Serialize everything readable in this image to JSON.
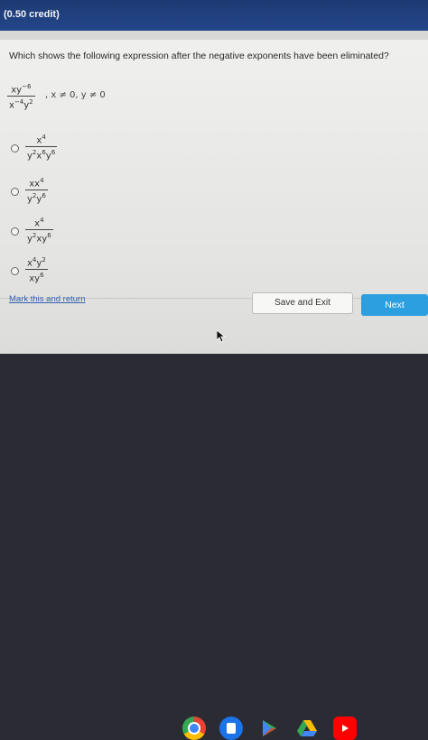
{
  "header": {
    "credit": "(0.50 credit)"
  },
  "question": {
    "text": "Which shows the following expression after the negative exponents have been eliminated?",
    "expr_num": "xy",
    "expr_num_exp": "−6",
    "expr_den_a": "x",
    "expr_den_a_exp": "−4",
    "expr_den_b": "y",
    "expr_den_b_exp": "2",
    "condition": ", x ≠ 0, y ≠ 0"
  },
  "options": [
    {
      "num": "x",
      "num_exp": "4",
      "den": "y",
      "den_exp1": "2",
      "den_mid": "x",
      "den_exp2": "6",
      "den_end": "y",
      "den_exp3": "6"
    },
    {
      "num": "xx",
      "num_exp": "4",
      "den": "y",
      "den_exp1": "2",
      "den_end": "y",
      "den_exp3": "6"
    },
    {
      "num": "x",
      "num_exp": "4",
      "den": "y",
      "den_exp1": "2",
      "den_mid": "xy",
      "den_exp2": "6"
    },
    {
      "num": "x",
      "num_exp": "4",
      "num2": "y",
      "num_exp2": "2",
      "den": "xy",
      "den_exp1": "6"
    }
  ],
  "footer": {
    "mark_label": "Mark this and return",
    "save_label": "Save and Exit",
    "next_label": "Next"
  },
  "colors": {
    "header": "#23468a",
    "next": "#2c9fe0",
    "link": "#2f62b0"
  },
  "shelf_icons": [
    "chrome-icon",
    "files-icon",
    "play-store-icon",
    "drive-icon",
    "youtube-icon"
  ]
}
